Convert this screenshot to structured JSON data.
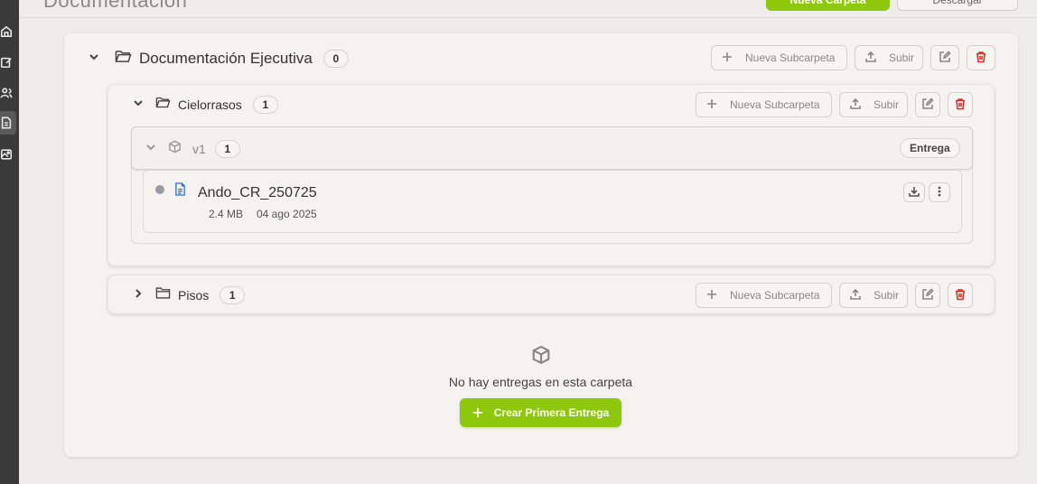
{
  "header": {
    "title": "Documentación",
    "primary_button": "Nueva Carpeta",
    "secondary_button": "Descargar"
  },
  "root_folder": {
    "name": "Documentación Ejecutiva",
    "count": "0",
    "new_subfolder_label": "Nueva Subcarpeta",
    "upload_label": "Subir"
  },
  "subfolders": [
    {
      "name": "Cielorrasos",
      "count": "1",
      "expanded": true,
      "new_subfolder_label": "Nueva Subcarpeta",
      "upload_label": "Subir",
      "version": {
        "name": "v1",
        "count": "1",
        "tag": "Entrega",
        "file": {
          "name": "Ando_CR_250725",
          "size": "2.4 MB",
          "date": "04 ago 2025"
        }
      }
    },
    {
      "name": "Pisos",
      "count": "1",
      "expanded": false,
      "new_subfolder_label": "Nueva Subcarpeta",
      "upload_label": "Subir"
    }
  ],
  "empty_state": {
    "message": "No hay entregas en esta carpeta",
    "cta_label": "Crear Primera Entrega"
  },
  "colors": {
    "accent": "#8dc80d",
    "danger": "#d9302c",
    "file_icon": "#2b6fd6"
  }
}
